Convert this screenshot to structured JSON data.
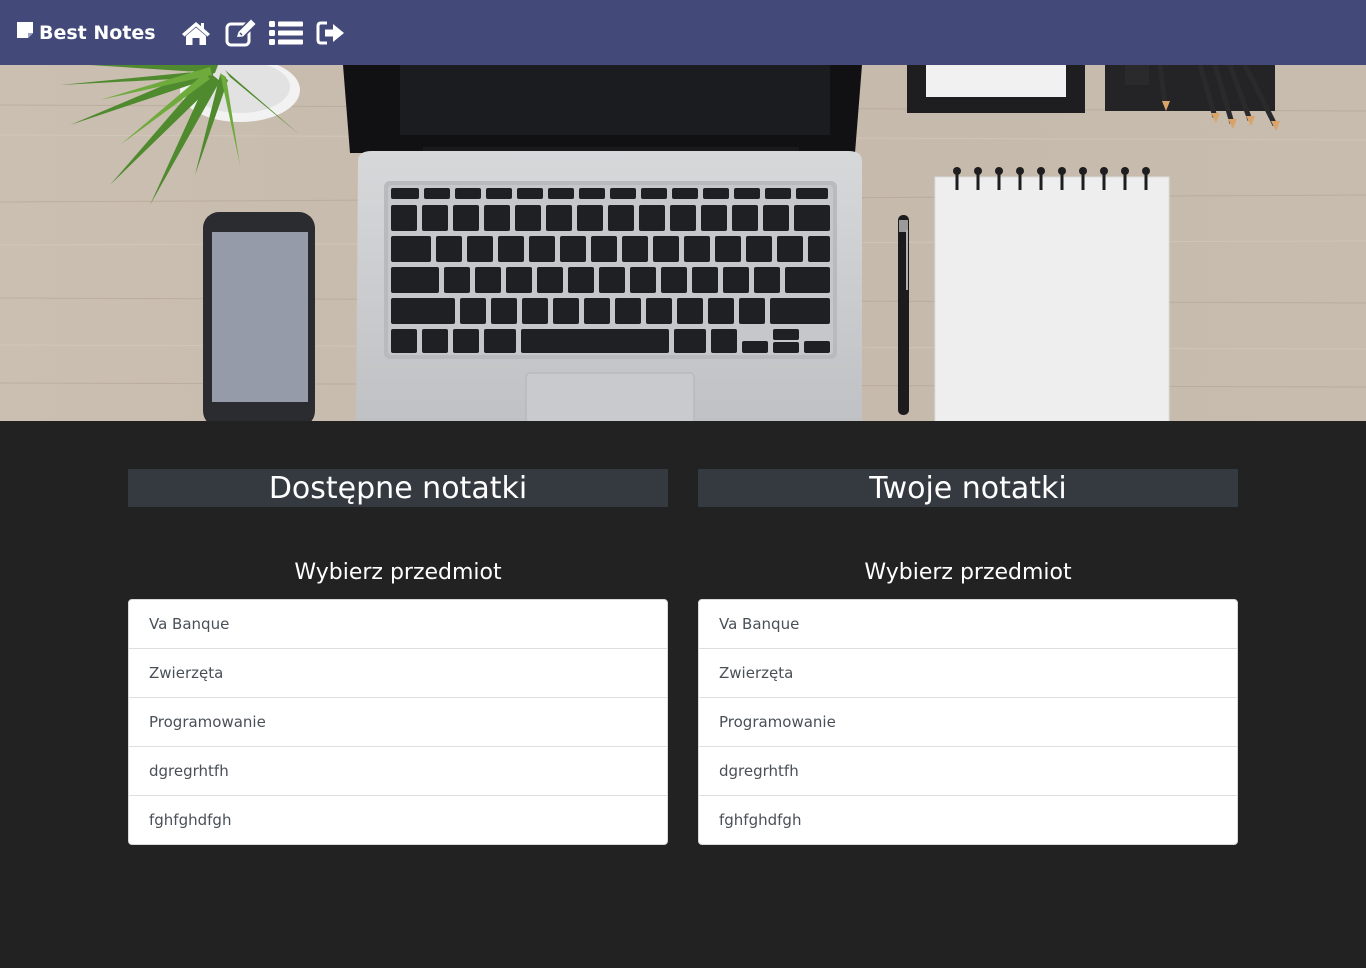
{
  "navbar": {
    "brand_label": "Best Notes",
    "brand_icon": "sticky-note-icon",
    "icons": [
      "home-icon",
      "edit-icon",
      "list-icon",
      "sign-out-icon"
    ],
    "background": "#434a7a"
  },
  "hero": {
    "image": "desk-with-laptop-phone-notebook-plant"
  },
  "available_notes": {
    "title": "Dostępne notatki",
    "subtitle": "Wybierz przedmiot",
    "items": [
      "Va Banque",
      "Zwierzęta",
      "Programowanie",
      "dgregrhtfh",
      "fghfghdfgh"
    ]
  },
  "your_notes": {
    "title": "Twoje notatki",
    "subtitle": "Wybierz przedmiot",
    "items": [
      "Va Banque",
      "Zwierzęta",
      "Programowanie",
      "dgregrhtfh",
      "fghfghdfgh"
    ]
  },
  "colors": {
    "page_background": "#222222",
    "section_header": "#343a40",
    "list_text": "#495057"
  }
}
